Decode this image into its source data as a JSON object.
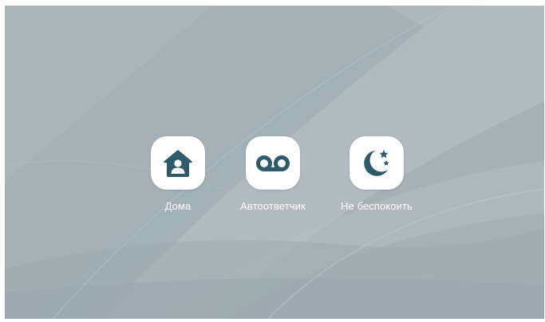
{
  "modes": [
    {
      "label": "Дома",
      "icon": "house-person-icon"
    },
    {
      "label": "Автоответчик",
      "icon": "voicemail-icon"
    },
    {
      "label": "Не беспокоить",
      "icon": "moon-stars-icon"
    }
  ],
  "colors": {
    "icon": "#2e5a6b",
    "tile": "#ffffff",
    "label": "#ffffff",
    "background": "#a6b1b5"
  }
}
